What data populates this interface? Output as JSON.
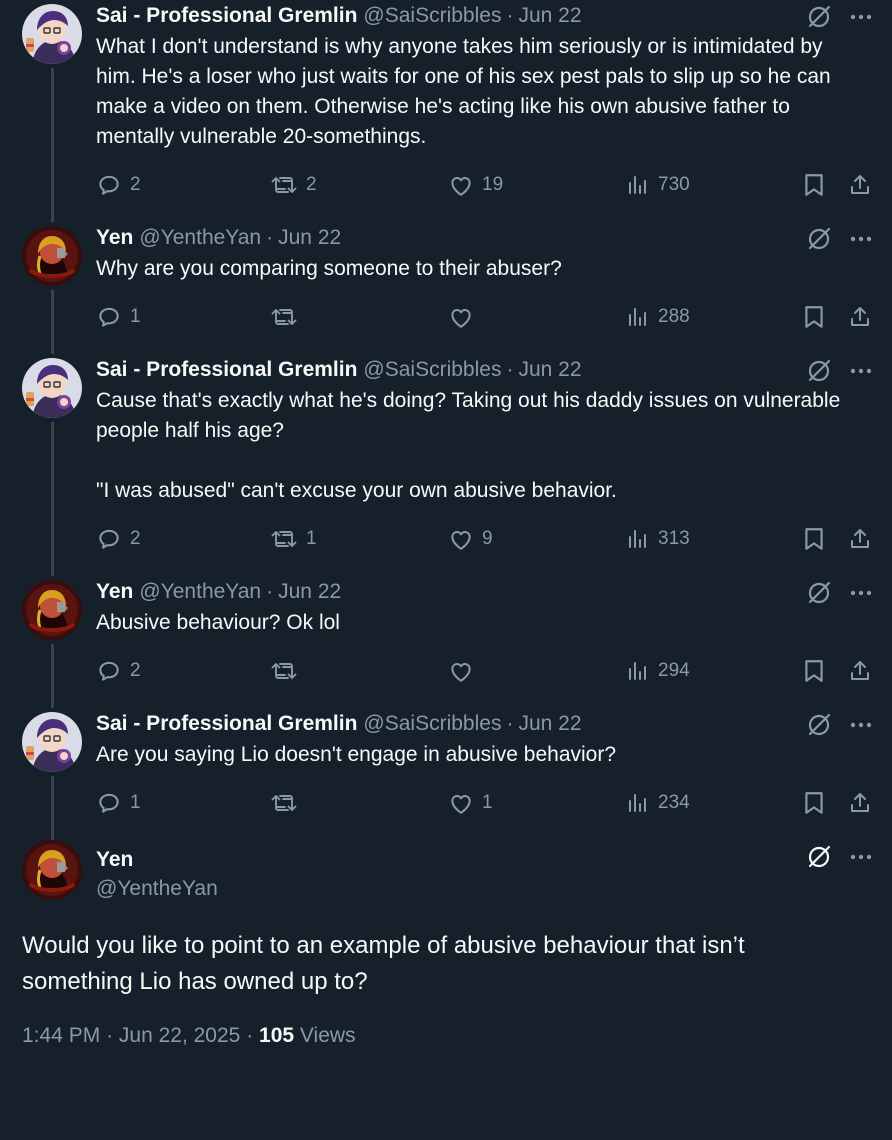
{
  "colors": {
    "background": "#15202b",
    "text": "#f7f9f9",
    "secondary": "#8b98a5",
    "thread_line": "#38444d"
  },
  "replies": [
    {
      "author": "sai",
      "name": "Sai - Professional Gremlin",
      "handle": "@SaiScribbles",
      "dot": "·",
      "date": "Jun 22",
      "text": "What I don't understand is why anyone takes him seriously or is intimidated by him. He's a loser who just waits for one of his sex pest pals to slip up so he can make a video on them. Otherwise he's acting like his own abusive father to mentally vulnerable 20-somethings.",
      "replies": "2",
      "reposts": "2",
      "likes": "19",
      "views": "730"
    },
    {
      "author": "yen",
      "name": "Yen",
      "handle": "@YentheYan",
      "dot": "·",
      "date": "Jun 22",
      "text": "Why are you comparing someone to their abuser?",
      "replies": "1",
      "reposts": "",
      "likes": "",
      "views": "288"
    },
    {
      "author": "sai",
      "name": "Sai - Professional Gremlin",
      "handle": "@SaiScribbles",
      "dot": "·",
      "date": "Jun 22",
      "text": "Cause that's exactly what he's doing? Taking out his daddy issues on vulnerable people half his age?\n\n\"I was abused\" can't excuse your own abusive behavior.",
      "replies": "2",
      "reposts": "1",
      "likes": "9",
      "views": "313"
    },
    {
      "author": "yen",
      "name": "Yen",
      "handle": "@YentheYan",
      "dot": "·",
      "date": "Jun 22",
      "text": "Abusive behaviour? Ok lol",
      "replies": "2",
      "reposts": "",
      "likes": "",
      "views": "294"
    },
    {
      "author": "sai",
      "name": "Sai - Professional Gremlin",
      "handle": "@SaiScribbles",
      "dot": "·",
      "date": "Jun 22",
      "text": "Are you saying Lio doesn't engage in abusive behavior?",
      "replies": "1",
      "reposts": "",
      "likes": "1",
      "views": "234"
    }
  ],
  "main": {
    "name": "Yen",
    "handle": "@YentheYan",
    "text": "Would you like to point to an example of abusive behaviour that isn’t something Lio has owned up to?",
    "time": "1:44 PM",
    "sep1": "·",
    "date": "Jun 22, 2025",
    "sep2": "·",
    "views_count": "105",
    "views_label": "Views"
  },
  "icons": {
    "reply": "reply-icon",
    "repost": "repost-icon",
    "like": "heart-icon",
    "views": "views-icon",
    "bookmark": "bookmark-icon",
    "share": "share-icon",
    "grok": "grok-icon",
    "more": "more-icon"
  }
}
